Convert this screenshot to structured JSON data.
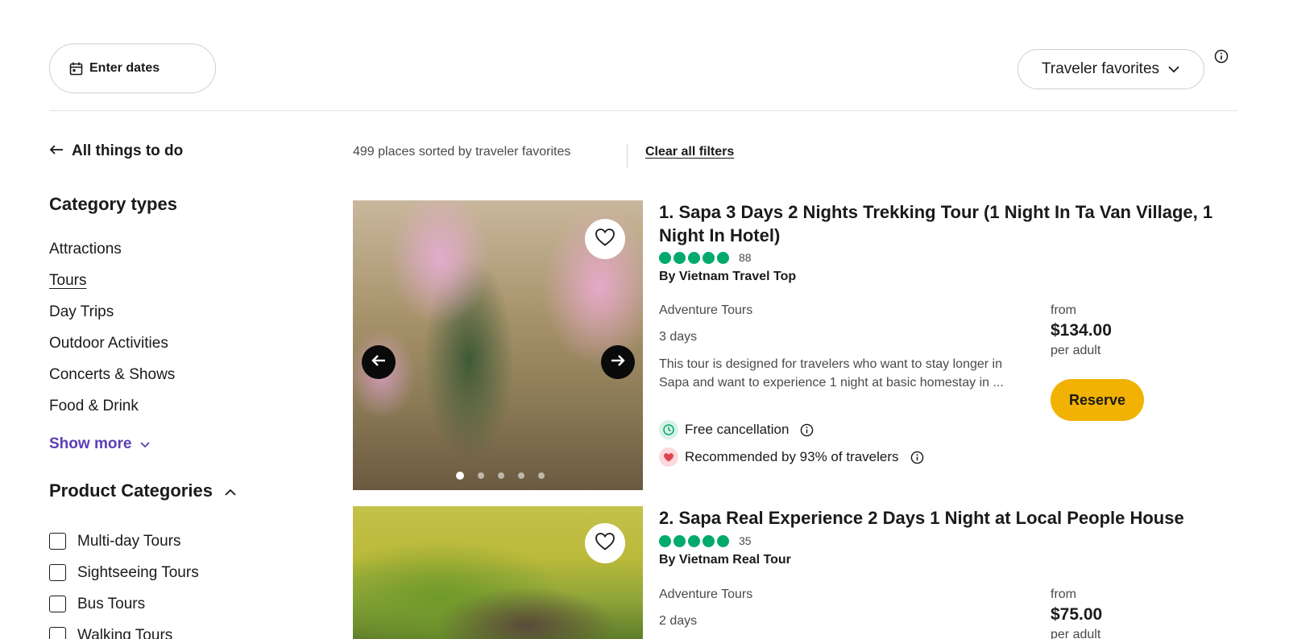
{
  "toolbar": {
    "date_label": "Enter dates",
    "sort_label": "Traveler favorites"
  },
  "sidebar": {
    "back_label": "All things to do",
    "category_title": "Category types",
    "categories": [
      {
        "label": "Attractions",
        "active": false
      },
      {
        "label": "Tours",
        "active": true
      },
      {
        "label": "Day Trips",
        "active": false
      },
      {
        "label": "Outdoor Activities",
        "active": false
      },
      {
        "label": "Concerts & Shows",
        "active": false
      },
      {
        "label": "Food & Drink",
        "active": false
      }
    ],
    "show_more_label": "Show more",
    "product_title": "Product Categories",
    "product_categories": [
      {
        "label": "Multi-day Tours",
        "checked": false
      },
      {
        "label": "Sightseeing Tours",
        "checked": false
      },
      {
        "label": "Bus Tours",
        "checked": false
      },
      {
        "label": "Walking Tours",
        "checked": false
      }
    ]
  },
  "results": {
    "summary": "499 places sorted by traveler favorites",
    "clear_label": "Clear all filters"
  },
  "listings": [
    {
      "title": "1. Sapa 3 Days 2 Nights Trekking Tour (1 Night In Ta Van Village, 1 Night In Hotel)",
      "rating": 5,
      "reviews": "88",
      "operator": "By Vietnam Travel Top",
      "category": "Adventure Tours",
      "duration": "3 days",
      "description": "This tour is designed for travelers who want to stay longer in Sapa and want to experience 1 night at basic homestay in ...",
      "free_cancellation": "Free cancellation",
      "recommended": "Recommended by 93% of travelers",
      "price_from": "from",
      "price": "$134.00",
      "per_adult": "per adult",
      "reserve_label": "Reserve",
      "image_dots": 5,
      "active_dot": 1
    },
    {
      "title": "2. Sapa Real Experience 2 Days 1 Night at Local People House",
      "rating": 5,
      "reviews": "35",
      "operator": "By Vietnam Real Tour",
      "category": "Adventure Tours",
      "duration": "2 days",
      "price_from": "from",
      "price": "$75.00",
      "per_adult": "per adult"
    }
  ],
  "colors": {
    "accent_purple": "#5b3fb5",
    "rating_green": "#00aa6c",
    "reserve_yellow": "#f2b203"
  },
  "icons": [
    "calendar-icon",
    "chevron-down-icon",
    "info-icon",
    "arrow-left-icon",
    "chevron-up-icon",
    "heart-icon",
    "arrow-right-icon",
    "rating-bubble-icon"
  ]
}
